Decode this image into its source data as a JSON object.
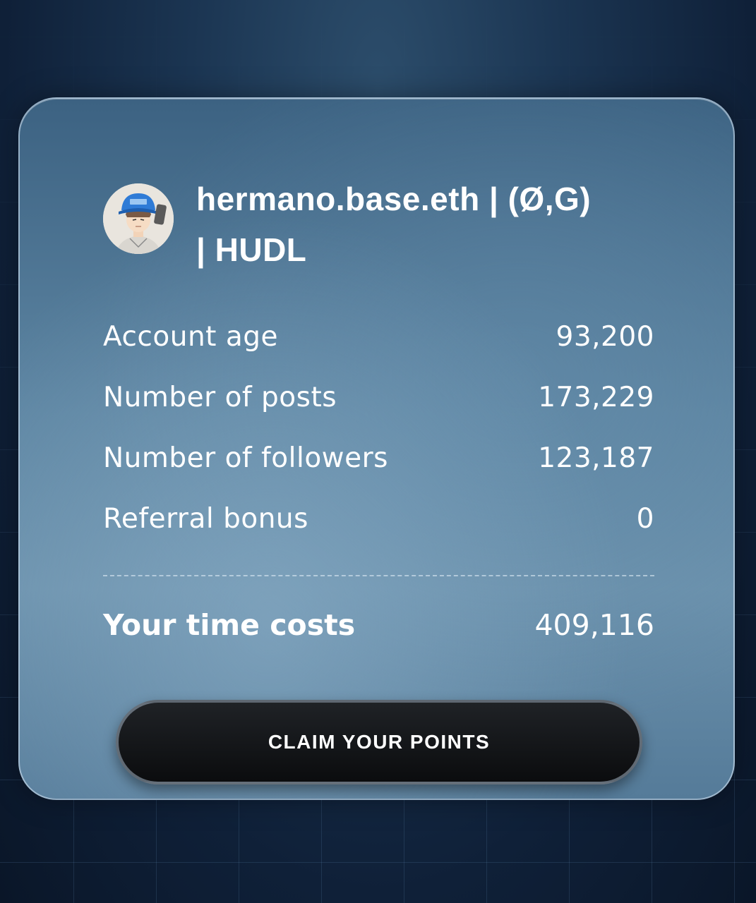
{
  "profile": {
    "username": "hermano.base.eth | (Ø,G) | HUDL"
  },
  "stats": [
    {
      "label": "Account age",
      "value": "93,200"
    },
    {
      "label": "Number of posts",
      "value": "173,229"
    },
    {
      "label": "Number of followers",
      "value": "123,187"
    },
    {
      "label": "Referral bonus",
      "value": "0"
    }
  ],
  "total": {
    "label": "Your time costs",
    "value": "409,116"
  },
  "actions": {
    "claim_label": "CLAIM YOUR POINTS"
  },
  "colors": {
    "card_tint": "#5e86a3",
    "button_bg": "#0b0c0e",
    "text": "#ffffff",
    "background": "#0f2038"
  }
}
